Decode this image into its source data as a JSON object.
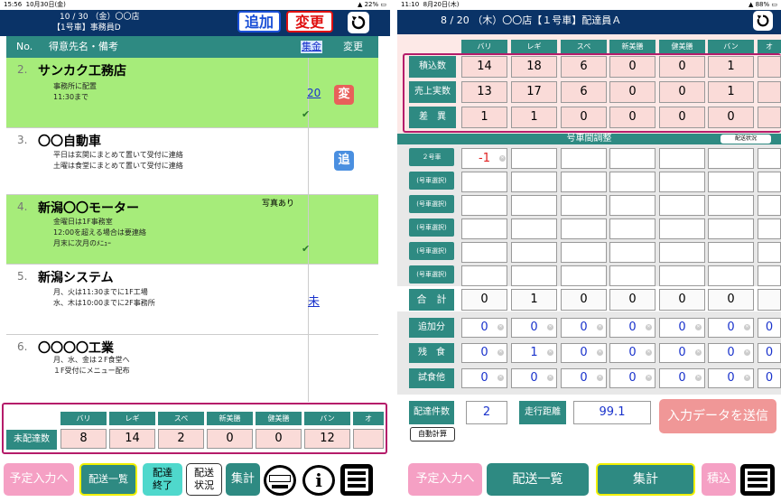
{
  "left": {
    "status": {
      "time": "15:56",
      "date": "10月30日(金)",
      "battery": "22%"
    },
    "header": {
      "line1": "10 / 30 （金）〇〇店",
      "line2": "【1号車】事務員D"
    },
    "btn_add": "追加",
    "btn_change": "変更",
    "thead": {
      "no": "No.",
      "name": "得意先名・備考",
      "collect": "集金",
      "change": "変更"
    },
    "rows": [
      {
        "no": "2.",
        "name": "サンカク工務店",
        "notes": [
          "事務所に配置",
          "11:30まで"
        ],
        "link": "20",
        "badge": "変"
      },
      {
        "no": "3.",
        "name": "〇〇自動車",
        "notes": [
          "平日は玄関にまとめて置いて受付に連絡",
          "土曜は食堂にまとめて置いて受付に連絡"
        ],
        "badge": "追"
      },
      {
        "no": "4.",
        "name": "新潟〇〇モーター",
        "photo": "写真あり",
        "notes": [
          "金曜日は1F事務室",
          "12:00を超える場合は要連絡",
          "月末に次月のﾒﾆｭｰ"
        ]
      },
      {
        "no": "5.",
        "name": "新潟システム",
        "notes": [
          "月、火は11:30までに1F工場",
          "水、木は10:00までに2F事務所"
        ],
        "link": "未"
      },
      {
        "no": "6.",
        "name": "〇〇〇〇工業",
        "notes": [
          "月、水、金は２F食堂へ",
          "１F受付にメニュー配布"
        ]
      }
    ],
    "summary": {
      "label": "未配達数",
      "cols": [
        "バリ",
        "レギ",
        "スペ",
        "新美膳",
        "健美膳",
        "バン",
        "オ"
      ],
      "values": [
        "8",
        "14",
        "2",
        "0",
        "0",
        "12",
        ""
      ]
    },
    "bottom": {
      "plan": "予定入力へ",
      "list": "配送一覧",
      "done1": "配達",
      "done2": "終了",
      "status1": "配送",
      "status2": "状況",
      "total": "集計",
      "info": "i"
    }
  },
  "right": {
    "status": {
      "time": "11:10",
      "date": "8月20日(木)",
      "battery": "88%"
    },
    "header": {
      "title": "8 / 20 （木）〇〇店【１号車】配達員Ａ"
    },
    "cols": [
      "バリ",
      "レギ",
      "スペ",
      "新美膳",
      "健美膳",
      "バン",
      "オ"
    ],
    "rows": [
      {
        "label": "積込数",
        "values": [
          "14",
          "18",
          "6",
          "0",
          "0",
          "1",
          ""
        ]
      },
      {
        "label": "売上実数",
        "values": [
          "13",
          "17",
          "6",
          "0",
          "0",
          "1",
          ""
        ]
      },
      {
        "label": "差　異",
        "values": [
          "1",
          "1",
          "0",
          "0",
          "0",
          "0",
          ""
        ]
      }
    ],
    "adjust": {
      "title": "号車間調整",
      "btn": "配送状況",
      "car2": "２号車",
      "car2_val": "-1",
      "select": "(号車選択)"
    },
    "total": {
      "label": "合　計",
      "values": [
        "0",
        "1",
        "0",
        "0",
        "0",
        "0",
        ""
      ]
    },
    "extra": [
      {
        "label": "追加分",
        "values": [
          "0",
          "0",
          "0",
          "0",
          "0",
          "0",
          "0"
        ]
      },
      {
        "label": "残　食",
        "values": [
          "0",
          "1",
          "0",
          "0",
          "0",
          "0",
          "0"
        ]
      },
      {
        "label": "試食他",
        "values": [
          "0",
          "0",
          "0",
          "0",
          "0",
          "0",
          "0"
        ]
      }
    ],
    "deliv_count": {
      "label": "配達件数",
      "value": "2"
    },
    "distance": {
      "label": "走行距離",
      "value": "99.1"
    },
    "send": "入力データを送信",
    "auto": "自動計算",
    "bottom": {
      "plan": "予定入力へ",
      "list": "配送一覧",
      "total": "集計",
      "load": "積込"
    }
  },
  "colors": {
    "header": "#0a3367",
    "teal": "#2e8a82",
    "green": "#a6ec7a",
    "pink": "#f5a0c4",
    "cell": "#fadbd8",
    "magenta": "#b51c6a"
  }
}
